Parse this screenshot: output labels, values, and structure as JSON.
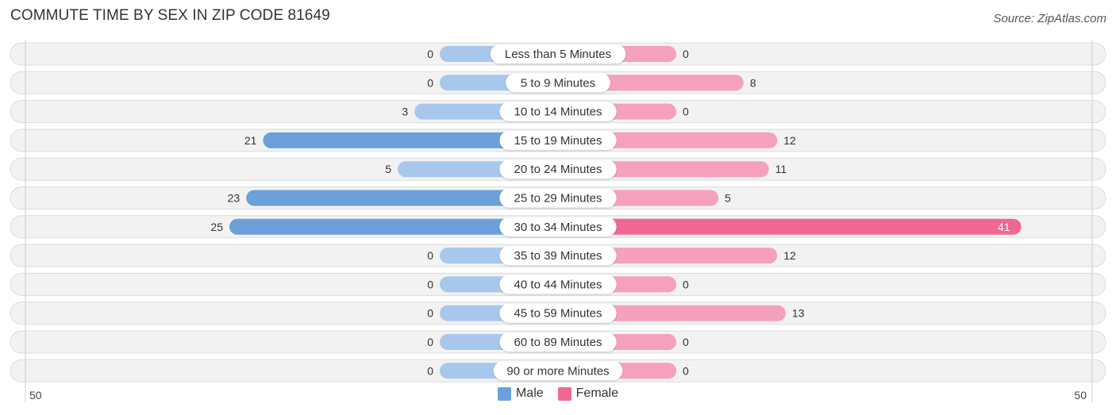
{
  "header": {
    "title": "COMMUTE TIME BY SEX IN ZIP CODE 81649",
    "source": "Source: ZipAtlas.com"
  },
  "colors": {
    "male_strong": "#6aa1da",
    "male_light": "#a7c8ec",
    "female_strong": "#f06892",
    "female_light": "#f5a0bc",
    "row_bg": "#f2f2f2"
  },
  "chart_data": {
    "type": "bar",
    "orientation": "horizontal-diverging",
    "title": "COMMUTE TIME BY SEX IN ZIP CODE 81649",
    "categories": [
      "Less than 5 Minutes",
      "5 to 9 Minutes",
      "10 to 14 Minutes",
      "15 to 19 Minutes",
      "20 to 24 Minutes",
      "25 to 29 Minutes",
      "30 to 34 Minutes",
      "35 to 39 Minutes",
      "40 to 44 Minutes",
      "45 to 59 Minutes",
      "60 to 89 Minutes",
      "90 or more Minutes"
    ],
    "series": [
      {
        "name": "Male",
        "values": [
          0,
          0,
          3,
          21,
          5,
          23,
          25,
          0,
          0,
          0,
          0,
          0
        ]
      },
      {
        "name": "Female",
        "values": [
          0,
          8,
          0,
          12,
          11,
          5,
          41,
          12,
          0,
          13,
          0,
          0
        ]
      }
    ],
    "axis": {
      "left_label": "50",
      "right_label": "50",
      "range": [
        0,
        50
      ]
    },
    "legend": {
      "position": "bottom-center",
      "entries": [
        "Male",
        "Female"
      ]
    }
  }
}
